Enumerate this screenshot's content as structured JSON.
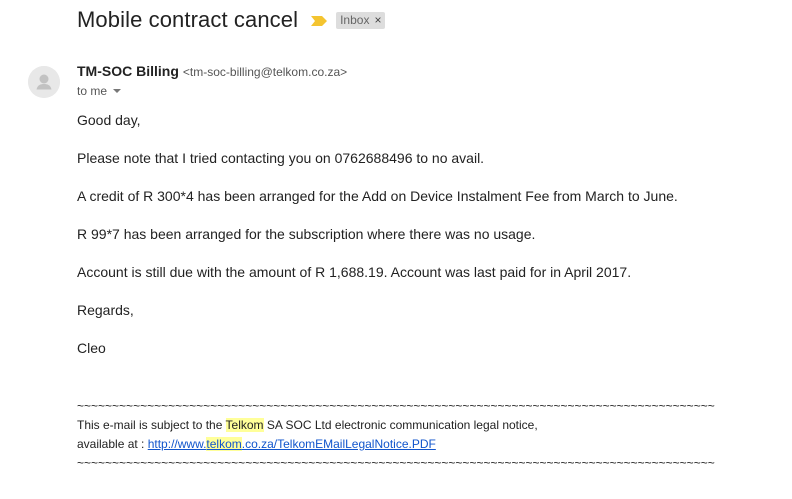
{
  "email": {
    "subject": "Mobile contract cancel",
    "label": "Inbox",
    "label_close": "×",
    "sender_name": "TM-SOC Billing",
    "sender_email": "<tm-soc-billing@telkom.co.za>",
    "to_text": "to me",
    "body": [
      "Good day,",
      "Please note that I tried contacting you on 0762688496 to no avail.",
      "A credit of R 300*4 has been arranged for the Add on Device Instalment Fee from March to June.",
      "R 99*7 has been arranged for the subscription where there was no usage.",
      "Account is still due with the amount of R 1,688.19. Account was last paid for in April 2017.",
      "Regards,",
      "Cleo"
    ],
    "footer": {
      "rule": "~~~~~~~~~~~~~~~~~~~~~~~~~~~~~~~~~~~~~~~~~~~~~~~~~~~~~~~~~~~~~~~~~~~~~~~~~~~~~~~~~~~~~~~~~~~",
      "notice_prefix": "This e-mail is subject to the ",
      "notice_brand": "Telkom",
      "notice_suffix": " SA SOC Ltd electronic communication legal notice,",
      "available_prefix": "available at : ",
      "link_part1": "http://www.",
      "link_brand": "telkom",
      "link_part2": ".co.za/TelkomEMailLegalNotice.PDF"
    }
  },
  "colors": {
    "importance_marker": "#f4c430",
    "label_bg": "#dddddd",
    "highlight": "#ffff99",
    "link": "#1155cc"
  },
  "icons": {
    "importance": "importance-marker-icon",
    "avatar": "default-avatar-icon",
    "caret": "caret-down-icon"
  }
}
